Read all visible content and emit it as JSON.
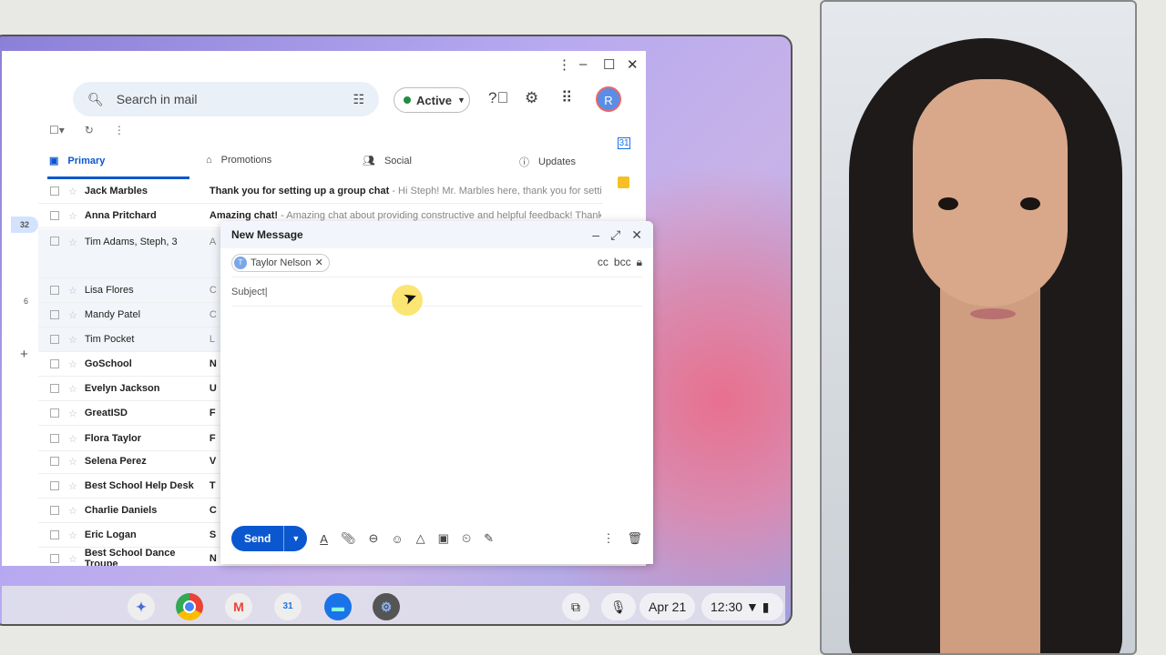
{
  "header": {
    "search_placeholder": "Search in mail",
    "status": "Active",
    "avatar_letter": "R"
  },
  "left_rail": {
    "badge": "32",
    "count": "6",
    "add": "+"
  },
  "tabs": [
    {
      "label": "Primary"
    },
    {
      "label": "Promotions"
    },
    {
      "label": "Social"
    },
    {
      "label": "Updates"
    }
  ],
  "emails": [
    {
      "sender": "Jack Marbles",
      "subject": "Thank you for setting up a group chat",
      "snippet": " - Hi Steph! Mr. Marbles here, thank you for setting up a gro",
      "unread": true
    },
    {
      "sender": "Anna Pritchard",
      "subject": "Amazing chat!",
      "snippet": " - Amazing chat about providing constructive and helpful feedback! Thank you Steph",
      "unread": true
    },
    {
      "sender": "Tim Adams, Steph, 3",
      "subject": "",
      "snippet": "A",
      "unread": false
    },
    {
      "sender": "Lisa Flores",
      "subject": "",
      "snippet": "C",
      "unread": false
    },
    {
      "sender": "Mandy Patel",
      "subject": "",
      "snippet": "C",
      "unread": false
    },
    {
      "sender": "Tim Pocket",
      "subject": "",
      "snippet": "L",
      "unread": false
    },
    {
      "sender": "GoSchool",
      "subject": "N",
      "snippet": "",
      "unread": true
    },
    {
      "sender": "Evelyn Jackson",
      "subject": "U",
      "snippet": "",
      "unread": true
    },
    {
      "sender": "GreatISD",
      "subject": "F",
      "snippet": "",
      "unread": true
    },
    {
      "sender": "Flora Taylor",
      "subject": "F",
      "snippet": "",
      "unread": true
    },
    {
      "sender": "Selena Perez",
      "subject": "V",
      "snippet": "",
      "unread": true
    },
    {
      "sender": "Best School Help Desk",
      "subject": "T",
      "snippet": "",
      "unread": true
    },
    {
      "sender": "Charlie Daniels",
      "subject": "C",
      "snippet": "",
      "unread": true
    },
    {
      "sender": "Eric Logan",
      "subject": "S",
      "snippet": "",
      "unread": true
    },
    {
      "sender": "Best School Dance Troupe",
      "subject": "N",
      "snippet": "",
      "unread": true
    }
  ],
  "compose": {
    "title": "New Message",
    "recipient": "Taylor Nelson",
    "recipient_initial": "T",
    "cc": "cc",
    "bcc": "bcc",
    "subject_placeholder": "Subject",
    "send": "Send"
  },
  "shelf": {
    "date": "Apr 21",
    "time": "12:30",
    "calendar_day": "31"
  },
  "colors": {
    "accent": "#0b57d0",
    "active_dot": "#1e8e3e"
  }
}
